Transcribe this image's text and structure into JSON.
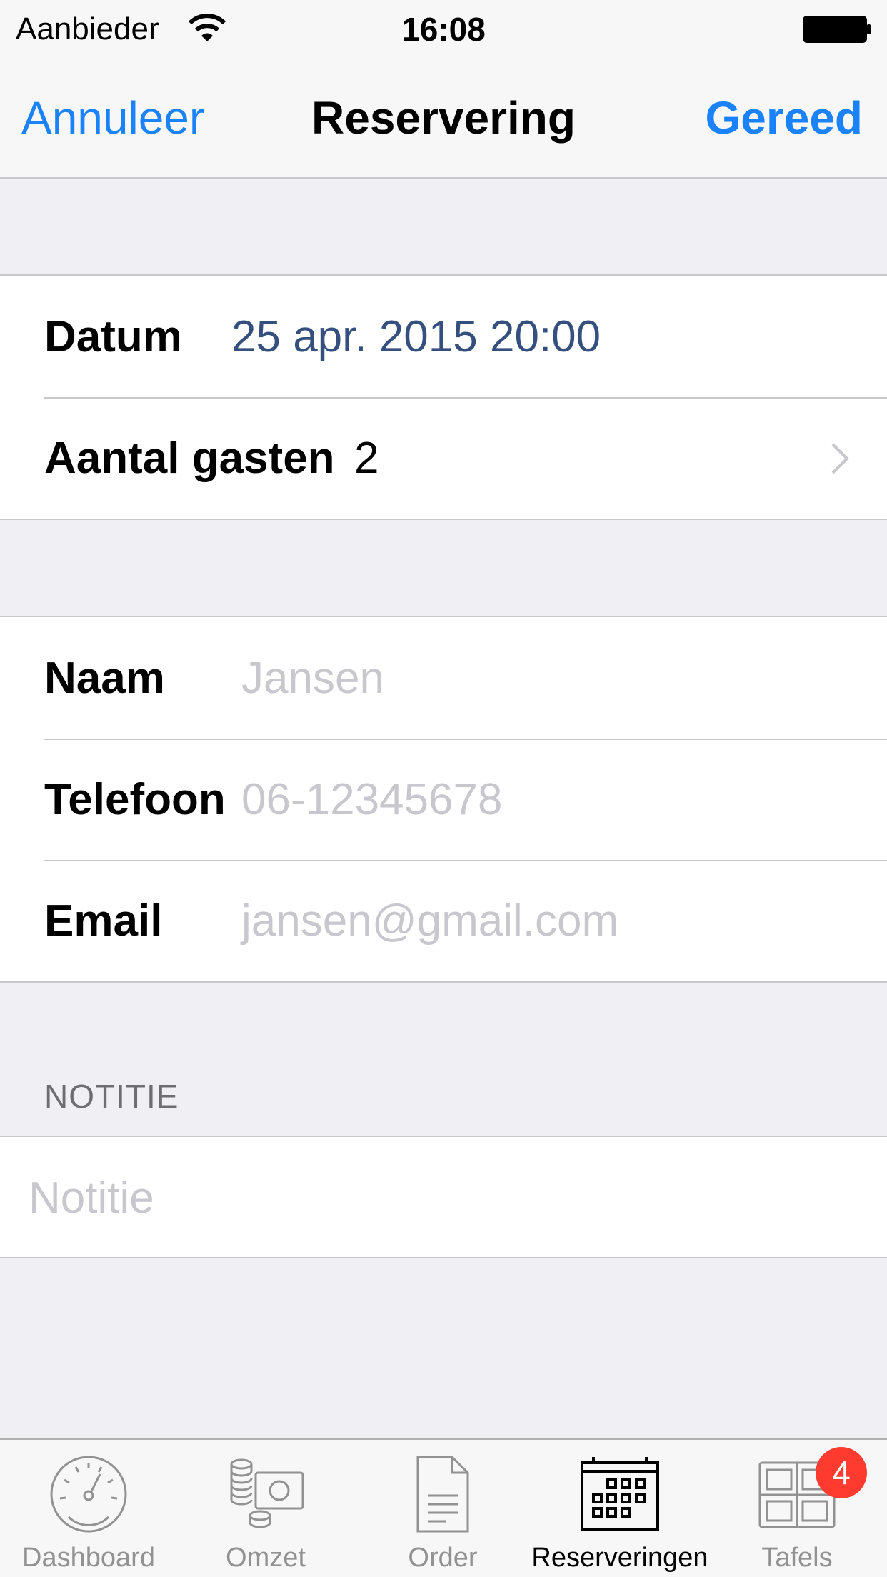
{
  "status_bar": {
    "carrier": "Aanbieder",
    "time": "16:08",
    "wifi_icon": "wifi-icon",
    "battery_icon": "battery-icon"
  },
  "nav": {
    "left_button": "Annuleer",
    "title": "Reservering",
    "right_button": "Gereed"
  },
  "booking": {
    "date_label": "Datum",
    "date_value": "25 apr. 2015 20:00",
    "guests_label": "Aantal gasten",
    "guests_value": "2"
  },
  "contact": {
    "name_label": "Naam",
    "name_placeholder": "Jansen",
    "phone_label": "Telefoon",
    "phone_placeholder": "06-12345678",
    "email_label": "Email",
    "email_placeholder": "jansen@gmail.com"
  },
  "note": {
    "header": "NOTITIE",
    "placeholder": "Notitie"
  },
  "tabbar": {
    "tabs": [
      {
        "label": "Dashboard",
        "icon": "speedometer-icon"
      },
      {
        "label": "Omzet",
        "icon": "money-icon"
      },
      {
        "label": "Order",
        "icon": "document-icon"
      },
      {
        "label": "Reserveringen",
        "icon": "calendar-icon",
        "active": true
      },
      {
        "label": "Tafels",
        "icon": "tables-icon",
        "badge": "4"
      }
    ]
  },
  "colors": {
    "accent": "#1a82fb",
    "date_value": "#35507f",
    "badge": "#ff3b30",
    "background": "#efeff4"
  }
}
